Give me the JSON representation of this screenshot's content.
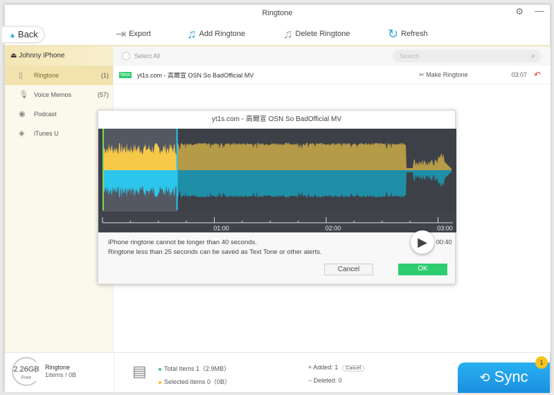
{
  "window": {
    "title": "Ringtone"
  },
  "toolbar": {
    "back": "Back",
    "export": "Export",
    "add": "Add Ringtone",
    "delete": "Delete Ringtone",
    "refresh": "Refresh"
  },
  "sidebar": {
    "device": "Johnny iPhone",
    "items": [
      {
        "label": "Ringtone",
        "count": "(1)",
        "icon": "phone-icon"
      },
      {
        "label": "Voice Memos",
        "count": "(57)",
        "icon": "microphone-icon"
      },
      {
        "label": "Podcast",
        "count": "",
        "icon": "podcast-icon"
      },
      {
        "label": "iTunes U",
        "count": "",
        "icon": "graduation-cap-icon"
      }
    ]
  },
  "list": {
    "select_all": "Select All",
    "search_placeholder": "Search",
    "rows": [
      {
        "badge": "New",
        "title": "yt1s.com - 高爾宣 OSN So BadOfficial MV",
        "action": "Make Ringtone",
        "duration": "03:07"
      }
    ]
  },
  "footer": {
    "free": "2.26GB",
    "free_label": "Free",
    "category": "Ringtone",
    "items": "1items / 0B",
    "total": "Total Items 1（2.9MB）",
    "selected": "Selected Items 0（0B）",
    "added": "+ Added: 1",
    "cancel": "Cancel",
    "deleted": "− Deleted: 0",
    "sync": "Sync",
    "sync_badge": "1"
  },
  "dialog": {
    "title": "yt1s.com - 高爾宣 OSN So BadOfficial MV",
    "ticks": [
      "01:00",
      "02:00",
      "03:00"
    ],
    "selection_length": "00:40",
    "selection_start_sec": 0,
    "selection_end_sec": 40,
    "total_duration": "03:07",
    "msg1": "iPhone ringtone cannot be longer than 40 seconds.",
    "msg2": "Ringtone less than 25 seconds can be saved as Text Tone or other alerts.",
    "cancel": "Cancel",
    "ok": "OK",
    "colors": {
      "selected_top": "#f7c948",
      "unselected_top": "#b59a48",
      "selected_bottom": "#2cc6ec",
      "unselected_bottom": "#1f8fa8",
      "background": "#3d4047",
      "selection_bg": "#545862"
    }
  }
}
